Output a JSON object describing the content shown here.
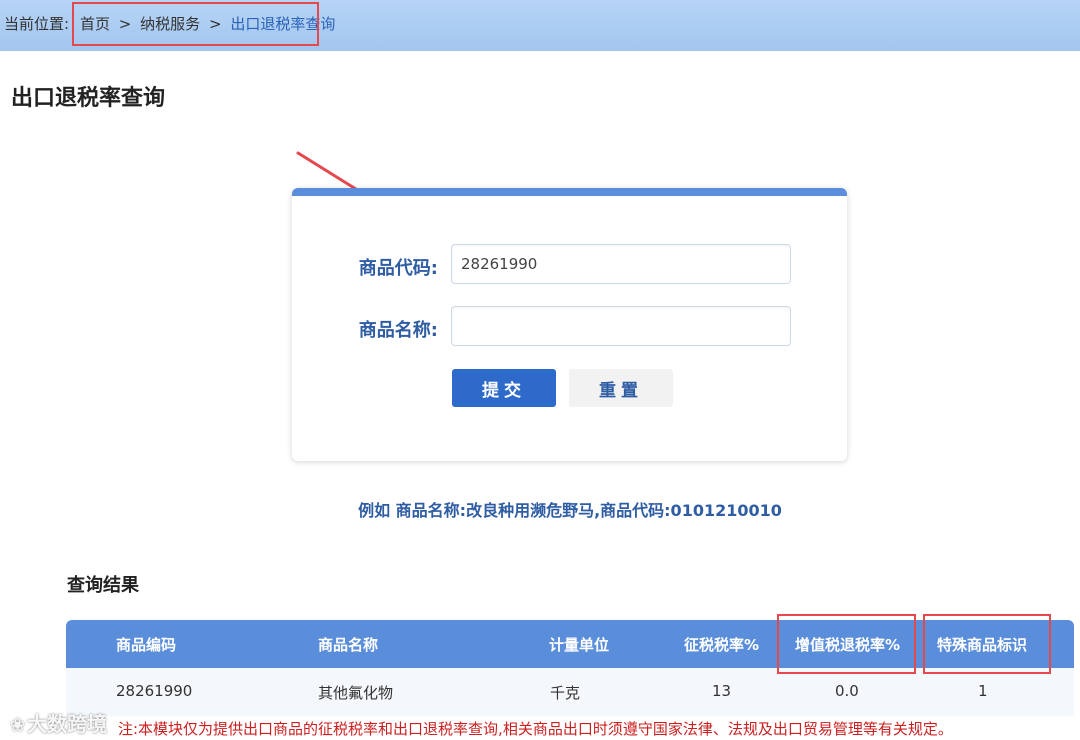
{
  "breadcrumb": {
    "prefix": "当前位置:",
    "items": [
      "首页",
      "纳税服务",
      "出口退税率查询"
    ],
    "separator": ">"
  },
  "page_title": "出口退税率查询",
  "form": {
    "code_label": "商品代码:",
    "code_value": "28261990",
    "name_label": "商品名称:",
    "name_value": "",
    "submit_label": "提交",
    "reset_label": "重置"
  },
  "example_text": "例如 商品名称:改良种用濒危野马,商品代码:0101210010",
  "results": {
    "title": "查询结果",
    "columns": [
      "商品编码",
      "商品名称",
      "计量单位",
      "征税税率%",
      "增值税退税率%",
      "特殊商品标识"
    ],
    "rows": [
      [
        "28261990",
        "其他氟化物",
        "千克",
        "13",
        "0.0",
        "1"
      ]
    ]
  },
  "note": "注:本模块仅为提供出口商品的征税税率和出口退税率查询,相关商品出口时须遵守国家法律、法规及出口贸易管理等有关规定。",
  "watermark": "大数跨境",
  "colors": {
    "topbar": "#a9cbf2",
    "accent": "#2f5da3",
    "primary_button": "#2d6ac9",
    "table_header": "#5a8edb",
    "annotation": "#e5484d",
    "note": "#cc1f1f"
  }
}
